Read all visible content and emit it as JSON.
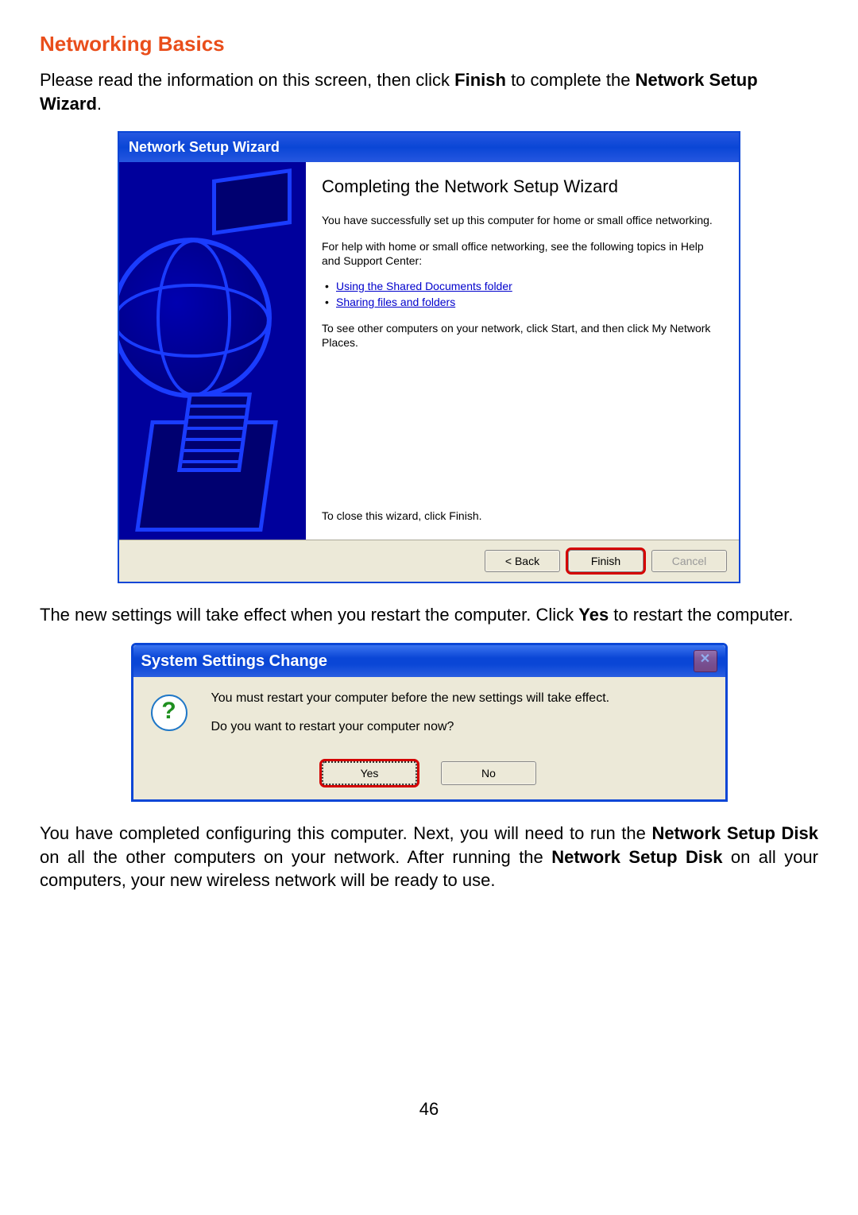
{
  "section_title": "Networking Basics",
  "intro": {
    "pre": "Please read the information on this screen, then click ",
    "bold1": "Finish",
    "mid": " to complete the ",
    "bold2": "Network Setup Wizard",
    "post": "."
  },
  "wizard": {
    "title": "Network Setup Wizard",
    "heading": "Completing the Network Setup Wizard",
    "p1": "You have successfully set up this computer for home or small office networking.",
    "p2": "For help with home or small office networking, see the following topics in Help and Support Center:",
    "links": [
      "Using the Shared Documents folder",
      "Sharing files and folders"
    ],
    "p3": "To see other computers on your network, click Start, and then click My Network Places.",
    "close_hint": "To close this wizard, click Finish.",
    "buttons": {
      "back": "< Back",
      "finish": "Finish",
      "cancel": "Cancel"
    }
  },
  "mid_text": {
    "pre": "The new settings will take effect when you restart the computer. Click ",
    "bold": "Yes",
    "post": " to restart the computer."
  },
  "dialog": {
    "title": "System Settings Change",
    "line1": "You must restart your computer before the new settings will take effect.",
    "line2": "Do you want to restart your computer now?",
    "yes": "Yes",
    "no": "No"
  },
  "outro": {
    "t1": "You have completed configuring this computer. Next, you will need to run the ",
    "b1": "Network Setup Disk",
    "t2": " on all the other computers on your network. After running the ",
    "b2": "Network Setup Disk",
    "t3": " on all your computers, your new wireless network will be ready to use."
  },
  "page_number": "46"
}
